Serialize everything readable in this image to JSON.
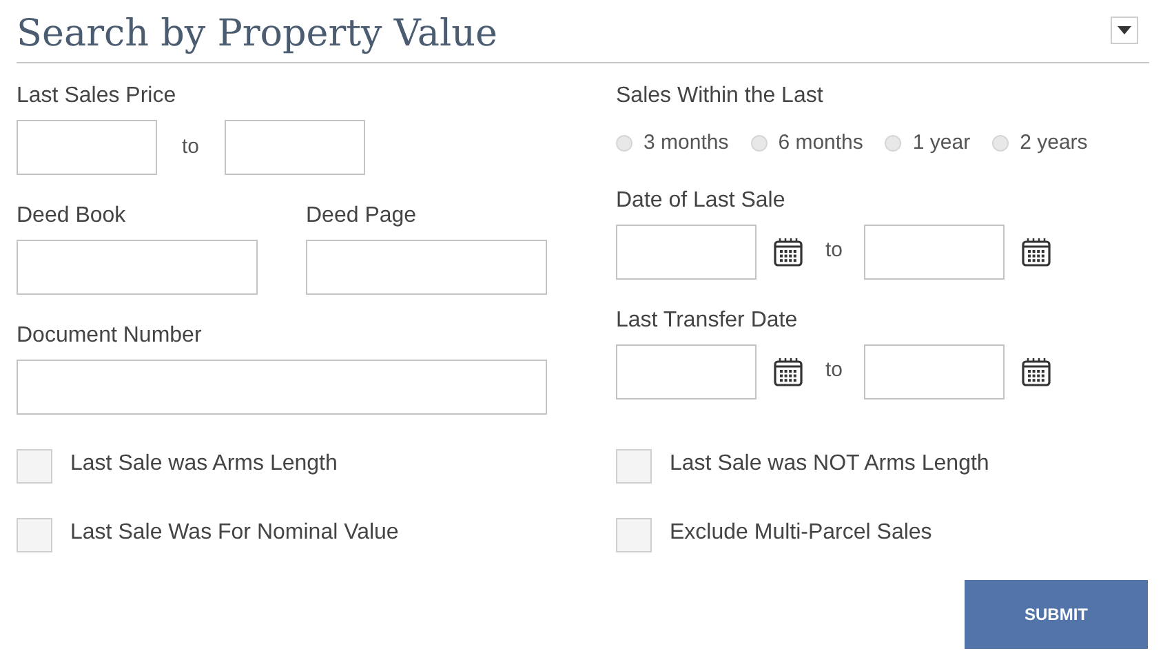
{
  "title": "Search by Property Value",
  "last_sales_price": {
    "label": "Last Sales Price",
    "to": "to"
  },
  "sales_within": {
    "label": "Sales Within the Last",
    "options": [
      {
        "label": "3 months",
        "selected": false
      },
      {
        "label": "6 months",
        "selected": false
      },
      {
        "label": "1 year",
        "selected": false
      },
      {
        "label": "2 years",
        "selected": false
      }
    ]
  },
  "deed_book": {
    "label": "Deed Book"
  },
  "deed_page": {
    "label": "Deed Page"
  },
  "date_of_last_sale": {
    "label": "Date of Last Sale",
    "to": "to"
  },
  "document_number": {
    "label": "Document Number"
  },
  "last_transfer_date": {
    "label": "Last Transfer Date",
    "to": "to"
  },
  "checkboxes": [
    {
      "label": "Last Sale was Arms Length",
      "checked": false
    },
    {
      "label": "Last Sale was NOT Arms Length",
      "checked": false
    },
    {
      "label": "Last Sale Was For Nominal Value",
      "checked": false
    },
    {
      "label": "Exclude Multi-Parcel Sales",
      "checked": false
    }
  ],
  "submit": "SUBMIT"
}
